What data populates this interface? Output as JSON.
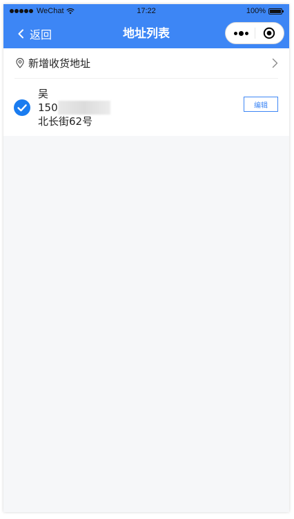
{
  "statusbar": {
    "carrier": "WeChat",
    "time": "17:22",
    "battery_text": "100%",
    "battery_level": 1.0
  },
  "navbar": {
    "back_label": "返回",
    "title": "地址列表",
    "color": "#3d86f5"
  },
  "add_address": {
    "label": "新增收货地址"
  },
  "addresses": [
    {
      "name": "吴",
      "phone_prefix": "150",
      "street": "北长街62号",
      "selected": true,
      "edit_label": "编辑"
    }
  ],
  "colors": {
    "accent": "#3d86f5",
    "check": "#1a7cf0",
    "background": "#f6f7f9"
  },
  "icons": {
    "back": "chevron-left-icon",
    "more": "more-dots-icon",
    "close": "target-circle-icon",
    "location": "location-pin-icon",
    "arrow": "chevron-right-icon",
    "check": "check-circle-icon",
    "wifi": "wifi-icon",
    "battery": "battery-icon"
  }
}
